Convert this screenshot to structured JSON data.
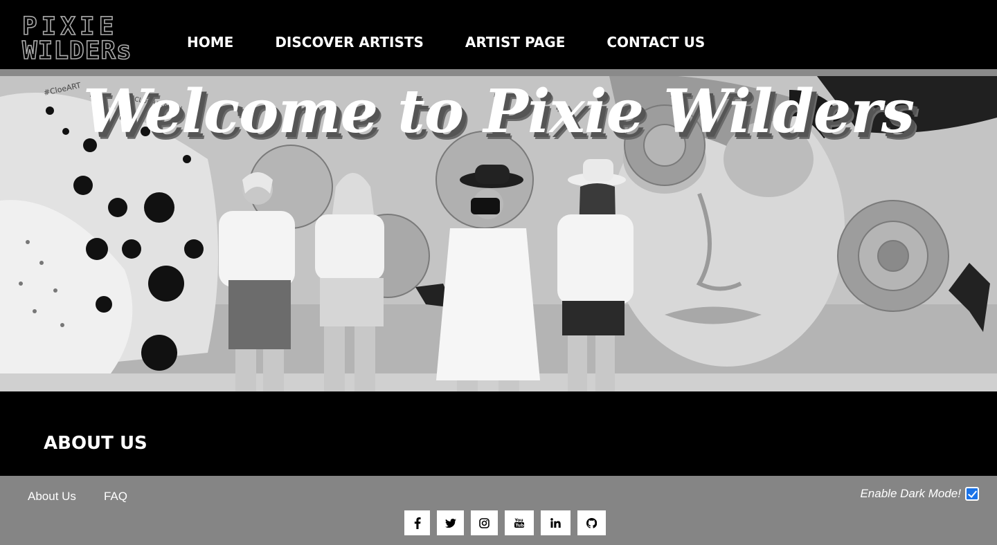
{
  "header": {
    "logo": {
      "line1": "PIXIE",
      "line2": "WILDERs"
    },
    "nav": [
      {
        "label": "HOME"
      },
      {
        "label": "DISCOVER ARTISTS"
      },
      {
        "label": "ARTIST PAGE"
      },
      {
        "label": "CONTACT US"
      }
    ]
  },
  "hero": {
    "title": "Welcome to Pixie Wilders",
    "mural_text": [
      "#CloeART",
      "@CLOEHAKAKIAN"
    ]
  },
  "about": {
    "heading": "ABOUT US"
  },
  "footer": {
    "links": [
      {
        "label": "About Us"
      },
      {
        "label": "FAQ"
      }
    ],
    "dark_mode_label": "Enable Dark Mode!",
    "dark_mode_checked": true,
    "socials": [
      {
        "icon": "facebook-icon"
      },
      {
        "icon": "twitter-icon"
      },
      {
        "icon": "instagram-icon"
      },
      {
        "icon": "youtube-icon"
      },
      {
        "icon": "linkedin-icon"
      },
      {
        "icon": "github-icon"
      }
    ]
  },
  "colors": {
    "background": "#000000",
    "divider": "#8a8a8a",
    "footer": "#858585",
    "checkbox": "#1a73e8"
  }
}
